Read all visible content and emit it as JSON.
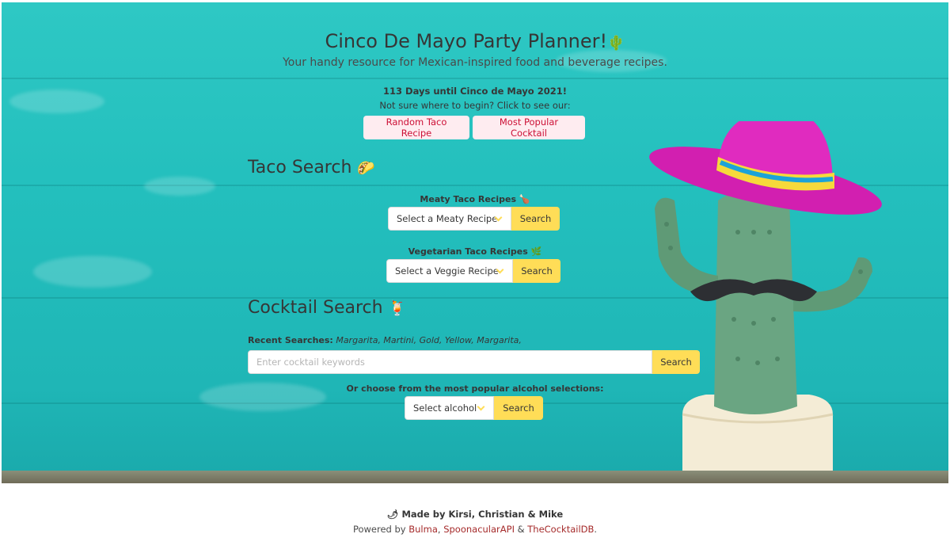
{
  "header": {
    "title": "Cinco De Mayo Party Planner!",
    "title_icon": "🌵",
    "subtitle": "Your handy resource for Mexican-inspired food and beverage recipes.",
    "countdown": "113 Days until Cinco de Mayo 2021!",
    "prompt": "Not sure where to begin? Click to see our:",
    "random_taco_label": "Random Taco Recipe",
    "popular_cocktail_label": "Most Popular Cocktail"
  },
  "taco": {
    "title": "Taco Search",
    "title_icon": "🌮",
    "meaty_label": "Meaty Taco Recipes",
    "meaty_icon": "🍗",
    "meaty_select": "Select a Meaty Recipe",
    "meaty_button": "Search",
    "veggie_label": "Vegetarian Taco Recipes",
    "veggie_icon": "🌿",
    "veggie_select": "Select a Veggie Recipe",
    "veggie_button": "Search"
  },
  "cocktail": {
    "title": "Cocktail Search",
    "title_icon": "🍹",
    "recent_label": "Recent Searches:",
    "recent_items": "Margarita, Martini, Gold, Yellow, Margarita,",
    "input_placeholder": "Enter cocktail keywords",
    "search_button": "Search",
    "alcohol_label": "Or choose from the most popular alcohol selections:",
    "alcohol_select": "Select alcohol",
    "alcohol_button": "Search"
  },
  "footer": {
    "made_icon": "🌶",
    "made_by": "Made by Kirsi, Christian & Mike",
    "powered_prefix": "Powered by ",
    "link_bulma": "Bulma",
    "sep1": ", ",
    "link_spoonacular": "SpoonacularAPI",
    "sep2": " & ",
    "link_cocktaildb": "TheCocktailDB",
    "suffix": "."
  },
  "colors": {
    "accent_yellow": "#ffdd57",
    "button_pink_bg": "#feecf0",
    "button_pink_text": "#cc0f35",
    "link_color": "#a52a2a",
    "background_teal": "#23bfbd"
  }
}
